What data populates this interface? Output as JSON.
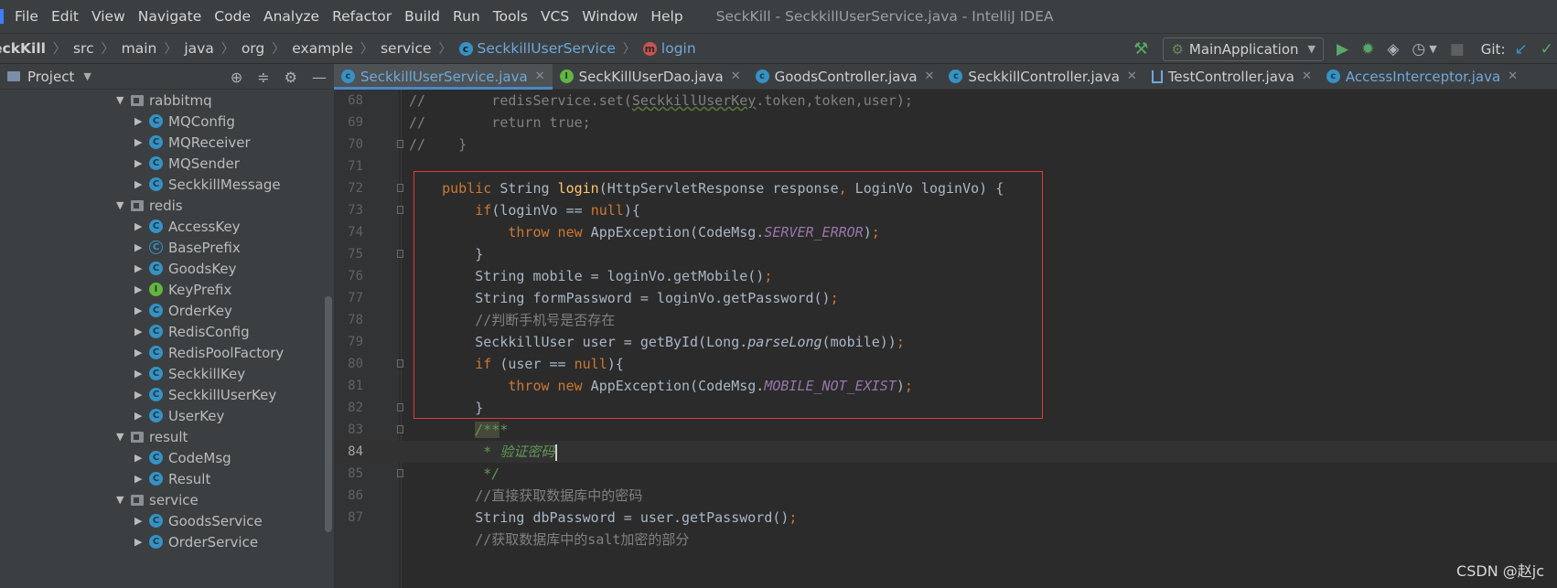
{
  "menubar": {
    "items": [
      "File",
      "Edit",
      "View",
      "Navigate",
      "Code",
      "Analyze",
      "Refactor",
      "Build",
      "Run",
      "Tools",
      "VCS",
      "Window",
      "Help"
    ],
    "window_title": "SeckKill - SeckkillUserService.java - IntelliJ IDEA"
  },
  "breadcrumb": {
    "items": [
      "eckKill",
      "src",
      "main",
      "java",
      "org",
      "example",
      "service"
    ],
    "class_name": "SeckkillUserService",
    "method_name": "login"
  },
  "toolbar": {
    "run_config": "MainApplication",
    "git_label": "Git:"
  },
  "project_panel": {
    "title": "Project",
    "tree": [
      {
        "type": "package",
        "label": "rabbitmq",
        "indent": 1
      },
      {
        "type": "class",
        "label": "MQConfig",
        "indent": 2
      },
      {
        "type": "class",
        "label": "MQReceiver",
        "indent": 2
      },
      {
        "type": "class",
        "label": "MQSender",
        "indent": 2
      },
      {
        "type": "class",
        "label": "SeckkillMessage",
        "indent": 2
      },
      {
        "type": "package",
        "label": "redis",
        "indent": 1
      },
      {
        "type": "class",
        "label": "AccessKey",
        "indent": 2
      },
      {
        "type": "abstract",
        "label": "BasePrefix",
        "indent": 2
      },
      {
        "type": "class",
        "label": "GoodsKey",
        "indent": 2
      },
      {
        "type": "interface",
        "label": "KeyPrefix",
        "indent": 2
      },
      {
        "type": "class",
        "label": "OrderKey",
        "indent": 2
      },
      {
        "type": "class",
        "label": "RedisConfig",
        "indent": 2
      },
      {
        "type": "class",
        "label": "RedisPoolFactory",
        "indent": 2
      },
      {
        "type": "class",
        "label": "SeckkillKey",
        "indent": 2
      },
      {
        "type": "class",
        "label": "SeckkillUserKey",
        "indent": 2
      },
      {
        "type": "class",
        "label": "UserKey",
        "indent": 2
      },
      {
        "type": "package",
        "label": "result",
        "indent": 1
      },
      {
        "type": "class",
        "label": "CodeMsg",
        "indent": 2
      },
      {
        "type": "class",
        "label": "Result",
        "indent": 2
      },
      {
        "type": "package",
        "label": "service",
        "indent": 1
      },
      {
        "type": "class",
        "label": "GoodsService",
        "indent": 2
      },
      {
        "type": "class",
        "label": "OrderService",
        "indent": 2
      }
    ]
  },
  "tabs": [
    {
      "label": "SeckkillUserService.java",
      "icon": "class",
      "active": true
    },
    {
      "label": "SeckKillUserDao.java",
      "icon": "interface",
      "active": false
    },
    {
      "label": "GoodsController.java",
      "icon": "class",
      "active": false
    },
    {
      "label": "SeckkillController.java",
      "icon": "class",
      "active": false
    },
    {
      "label": "TestController.java",
      "icon": "controller",
      "active": false
    },
    {
      "label": "AccessInterceptor.java",
      "icon": "class",
      "active": false
    }
  ],
  "editor": {
    "line_numbers": [
      "68",
      "69",
      "70",
      "71",
      "72",
      "73",
      "74",
      "75",
      "76",
      "77",
      "78",
      "79",
      "80",
      "81",
      "82",
      "83",
      "84",
      "85",
      "86",
      "87"
    ],
    "current_line": "84"
  },
  "watermark": "CSDN @赵jc"
}
